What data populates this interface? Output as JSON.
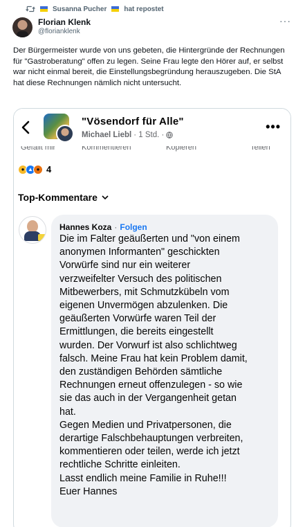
{
  "repost": {
    "reposter": "Susanna Pucher",
    "suffix": "hat repostet"
  },
  "tweet": {
    "author_name": "Florian Klenk",
    "author_handle": "@florianklenk",
    "more": "···",
    "text": "Der Bürgermeister wurde von uns gebeten, die Hintergründe der Rechnungen für \"Gastroberatung\" offen zu legen. Seine Frau legte den Hörer auf, er selbst war nicht einmal bereit, die Einstellungsbegründung herauszugeben. Die StA hat diese Rechnungen nämlich nicht untersucht."
  },
  "fb_post": {
    "group_title": "\"Vösendorf für Alle\"",
    "post_author": "Michael Liebl",
    "post_time": "· 1 Std. ·",
    "more": "•••",
    "cut_off_labels": [
      "Gefällt mir",
      "Kommentieren",
      "Kopieren",
      "Teilen"
    ],
    "reaction_count": "4",
    "sort_label": "Top-Kommentare"
  },
  "comment": {
    "name": "Hannes Koza",
    "separator": "·",
    "follow": "Folgen",
    "lines": [
      "Die im Falter geäußerten und \"von einem",
      "anonymen Informanten\" geschickten",
      "Vorwürfe sind nur ein weiterer",
      "verzweifelter Versuch des politischen",
      "Mitbewerbers, mit Schmutzkübeln vom",
      "eigenen Unvermögen abzulenken. Die",
      "geäußerten Vorwürfe waren Teil der",
      "Ermittlungen, die bereits eingestellt",
      "wurden. Der Vorwurf ist also schlichtweg",
      "falsch. Meine Frau hat kein Problem damit,",
      "den zuständigen Behörden sämtliche",
      "Rechnungen erneut offenzulegen - so wie",
      "sie das auch in der Vergangenheit getan",
      "hat.",
      "Gegen Medien und Privatpersonen, die",
      "derartige Falschbehauptungen verbreiten,",
      "kommentieren oder teilen, werde ich jetzt",
      "rechtliche Schritte einleiten.",
      "Lasst endlich meine Familie in Ruhe!!!",
      "Euer Hannes"
    ]
  },
  "colors": {
    "secondary_text": "#536471",
    "fb_blue": "#1877f2",
    "bubble_bg": "#f0f2f5"
  },
  "icons": {
    "repost": "repost-icon",
    "back": "back-arrow-icon",
    "globe": "globe-icon",
    "chevron": "chevron-down-icon"
  }
}
